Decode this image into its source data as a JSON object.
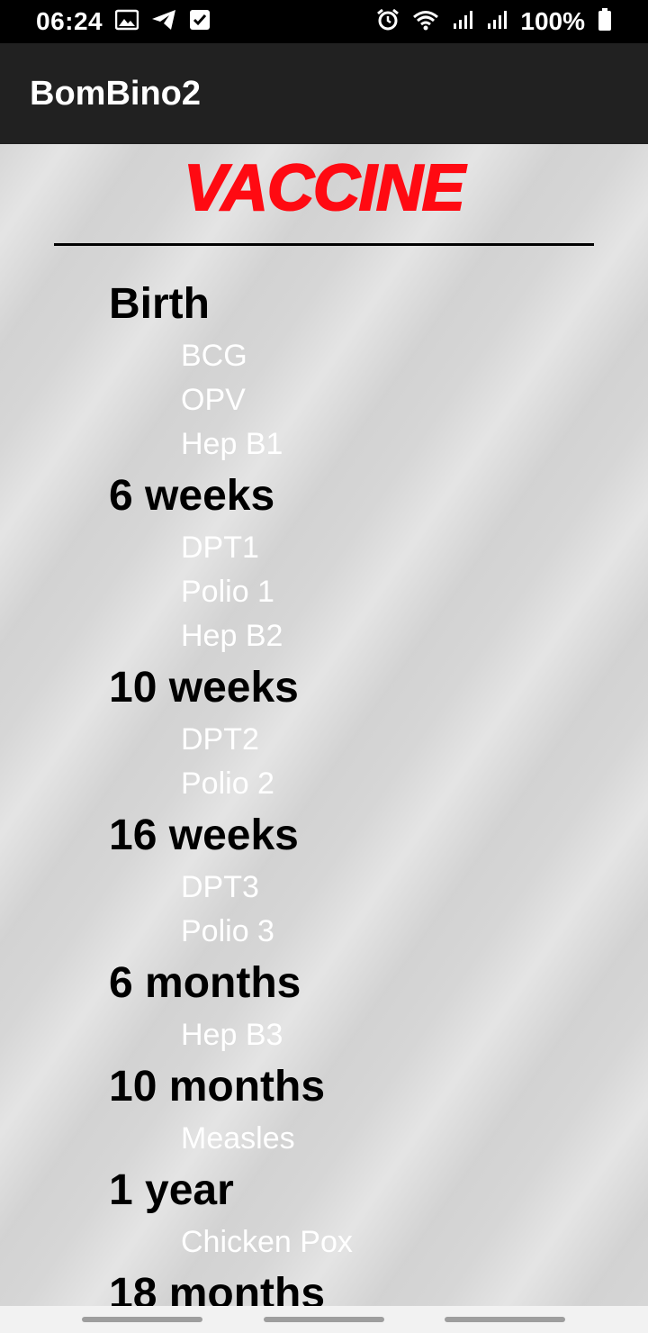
{
  "status_bar": {
    "time": "06:24",
    "battery": "100%",
    "icons": [
      "image-icon",
      "telegram-icon",
      "checkbox-icon",
      "alarm-icon",
      "wifi-icon",
      "signal-icon",
      "signal-icon",
      "battery-icon"
    ]
  },
  "app_bar": {
    "title": "BomBino2"
  },
  "page": {
    "heading": "VACCINE",
    "heading_color": "#ff0a12"
  },
  "schedule": [
    {
      "title": "Birth",
      "vaccines": [
        "BCG",
        "OPV",
        "Hep B1"
      ]
    },
    {
      "title": "6 weeks",
      "vaccines": [
        "DPT1",
        "Polio 1",
        "Hep B2"
      ]
    },
    {
      "title": "10 weeks",
      "vaccines": [
        "DPT2",
        "Polio 2"
      ]
    },
    {
      "title": "16 weeks",
      "vaccines": [
        "DPT3",
        "Polio 3"
      ]
    },
    {
      "title": "6 months",
      "vaccines": [
        "Hep B3"
      ]
    },
    {
      "title": "10 months",
      "vaccines": [
        "Measles"
      ]
    },
    {
      "title": "1 year",
      "vaccines": [
        "Chicken Pox"
      ]
    },
    {
      "title": "18 months",
      "vaccines": []
    }
  ]
}
